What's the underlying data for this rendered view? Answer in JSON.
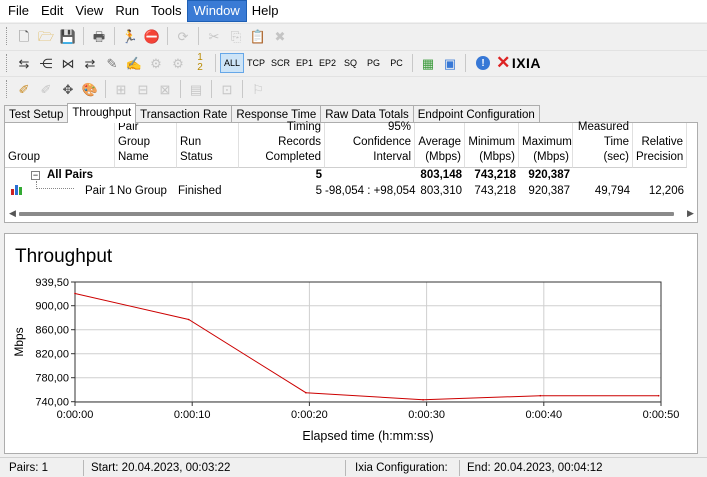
{
  "menu": [
    "File",
    "Edit",
    "View",
    "Run",
    "Tools",
    "Window",
    "Help"
  ],
  "menu_active_index": 5,
  "toolbar2_text_buttons": [
    "ALL",
    "TCP",
    "SCR",
    "EP1",
    "EP2",
    "SQ",
    "PG",
    "PC"
  ],
  "logo_text": "IXIA",
  "tabs": [
    "Test Setup",
    "Throughput",
    "Transaction Rate",
    "Response Time",
    "Raw Data Totals",
    "Endpoint Configuration"
  ],
  "active_tab_index": 1,
  "grid": {
    "headers": {
      "group": "Group",
      "pair_group_name": "Pair Group Name",
      "run_status": "Run Status",
      "timing_records": "Timing Records Completed",
      "confidence": "95% Confidence Interval",
      "average": "Average (Mbps)",
      "minimum": "Minimum (Mbps)",
      "maximum": "Maximum (Mbps)",
      "measured_time": "Measured Time (sec)",
      "relative_precision": "Relative Precision"
    },
    "all_pairs": {
      "expander": "−",
      "label": "All Pairs",
      "timing_records": "5",
      "average": "803,148",
      "minimum": "743,218",
      "maximum": "920,387"
    },
    "pair1": {
      "label": "Pair 1",
      "group_name": "No Group",
      "status": "Finished",
      "timing_records": "5",
      "confidence": "-98,054 : +98,054",
      "average": "803,310",
      "minimum": "743,218",
      "maximum": "920,387",
      "measured_time": "49,794",
      "relative_precision": "12,206"
    }
  },
  "chart_title": "Throughput",
  "chart_data": {
    "type": "line",
    "title": "Throughput",
    "xlabel": "Elapsed time (h:mm:ss)",
    "ylabel": "Mbps",
    "xlim": [
      0,
      50
    ],
    "ylim": [
      739.5,
      939.5
    ],
    "x_ticks": [
      "0:00:00",
      "0:00:10",
      "0:00:20",
      "0:00:30",
      "0:00:40",
      "0:00:50"
    ],
    "y_ticks": [
      "939,50",
      "900,00",
      "860,00",
      "820,00",
      "780,00",
      "740,00"
    ],
    "y_tick_values": [
      939.5,
      900,
      860,
      820,
      780,
      740
    ],
    "grid": true,
    "line_color": "#cc0000",
    "series": [
      {
        "x": [
          0,
          9.7,
          19.7,
          29.7,
          39.7,
          49.8
        ],
        "values": [
          920.4,
          877.0,
          755.0,
          743.2,
          750.0,
          750.0
        ]
      }
    ]
  },
  "status": {
    "pairs": "Pairs: 1",
    "start": "Start: 20.04.2023, 00:03:22",
    "ixia_config": "Ixia Configuration:",
    "end": "End: 20.04.2023, 00:04:12"
  }
}
